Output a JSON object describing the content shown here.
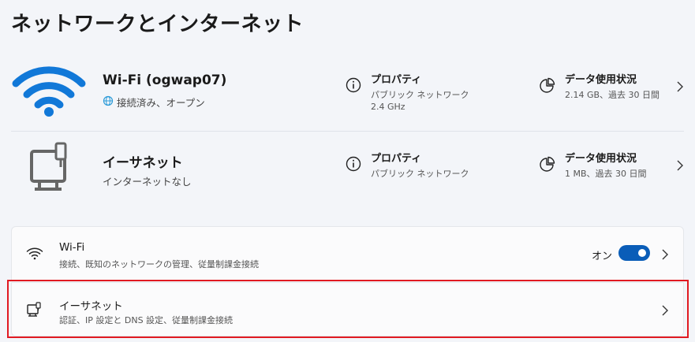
{
  "page": {
    "title": "ネットワークとインターネット"
  },
  "wifi_hero": {
    "name": "Wi-Fi (ogwap07)",
    "status": "接続済み、オープン",
    "properties": {
      "title": "プロパティ",
      "line1": "パブリック ネットワーク",
      "line2": "2.4 GHz"
    },
    "usage": {
      "title": "データ使用状況",
      "line1": "2.14 GB、過去 30 日間"
    }
  },
  "ethernet_hero": {
    "name": "イーサネット",
    "status": "インターネットなし",
    "properties": {
      "title": "プロパティ",
      "line1": "パブリック ネットワーク"
    },
    "usage": {
      "title": "データ使用状況",
      "line1": "1 MB、過去 30 日間"
    }
  },
  "settings_cards": {
    "wifi": {
      "title": "Wi-Fi",
      "subtitle": "接続、既知のネットワークの管理、従量制課金接続",
      "toggle_label": "オン",
      "toggle_on": true
    },
    "ethernet": {
      "title": "イーサネット",
      "subtitle": "認証、IP 設定と DNS 設定、従量制課金接続"
    }
  },
  "colors": {
    "accent": "#0a5db8",
    "wifi_icon": "#1178d8",
    "highlight": "#e11a22"
  }
}
